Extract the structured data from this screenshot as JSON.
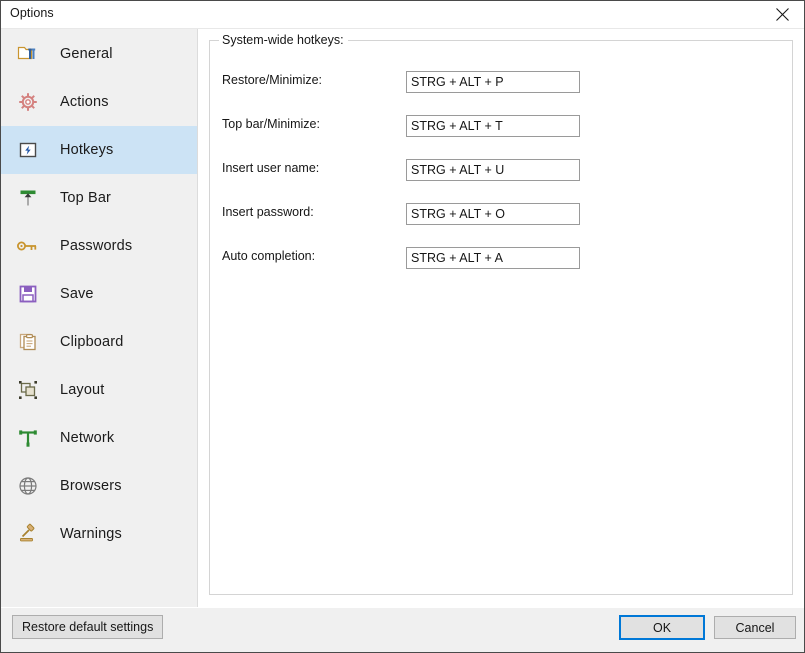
{
  "window": {
    "title": "Options",
    "close_label": "Close"
  },
  "sidebar": {
    "items": [
      {
        "label": "General",
        "icon": "folder-tools-icon",
        "selected": false
      },
      {
        "label": "Actions",
        "icon": "gear-icon",
        "selected": false
      },
      {
        "label": "Hotkeys",
        "icon": "lightning-key-icon",
        "selected": true
      },
      {
        "label": "Top Bar",
        "icon": "top-bar-arrow-icon",
        "selected": false
      },
      {
        "label": "Passwords",
        "icon": "key-icon",
        "selected": false
      },
      {
        "label": "Save",
        "icon": "floppy-disk-icon",
        "selected": false
      },
      {
        "label": "Clipboard",
        "icon": "clipboard-icon",
        "selected": false
      },
      {
        "label": "Layout",
        "icon": "layout-icon",
        "selected": false
      },
      {
        "label": "Network",
        "icon": "network-icon",
        "selected": false
      },
      {
        "label": "Browsers",
        "icon": "globe-icon",
        "selected": false
      },
      {
        "label": "Warnings",
        "icon": "gavel-icon",
        "selected": false
      }
    ]
  },
  "main": {
    "group_title": "System-wide hotkeys:",
    "hotkeys": [
      {
        "label": "Restore/Minimize:",
        "value": "STRG + ALT + P"
      },
      {
        "label": "Top bar/Minimize:",
        "value": "STRG + ALT + T"
      },
      {
        "label": "Insert user name:",
        "value": "STRG + ALT + U"
      },
      {
        "label": "Insert password:",
        "value": "STRG + ALT + O"
      },
      {
        "label": "Auto completion:",
        "value": "STRG + ALT + A"
      }
    ]
  },
  "footer": {
    "restore_defaults_label": "Restore default settings",
    "ok_label": "OK",
    "cancel_label": "Cancel"
  },
  "colors": {
    "selection": "#cce3f5",
    "accent": "#0078d7",
    "sidebar_bg": "#f0f0f0",
    "content_bg": "#ffffff",
    "border": "#d4d4d4"
  }
}
